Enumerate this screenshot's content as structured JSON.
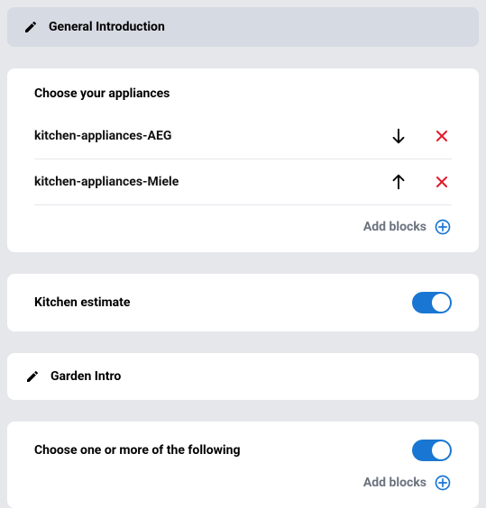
{
  "header": {
    "title": "General Introduction"
  },
  "appliances": {
    "title": "Choose your appliances",
    "items": [
      {
        "label": "kitchen-appliances-AEG"
      },
      {
        "label": "kitchen-appliances-Miele"
      }
    ],
    "add_label": "Add blocks"
  },
  "estimate": {
    "label": "Kitchen estimate"
  },
  "garden": {
    "title": "Garden Intro"
  },
  "choose": {
    "title": "Choose one or more of the following",
    "add_label": "Add blocks"
  }
}
